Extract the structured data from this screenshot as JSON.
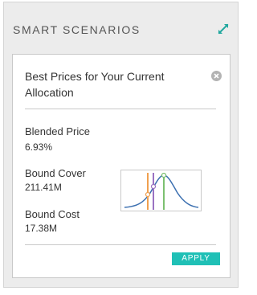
{
  "panel": {
    "title": "SMART SCENARIOS",
    "expand_icon": "expand-icon"
  },
  "card": {
    "title": "Best Prices for Your Current Allocation",
    "close_icon": "close-icon",
    "metrics": [
      {
        "label": "Blended Price",
        "value": "6.93%"
      },
      {
        "label": "Bound Cover",
        "value": "211.41M"
      },
      {
        "label": "Bound Cost",
        "value": "17.38M"
      }
    ],
    "apply_label": "APPLY"
  },
  "colors": {
    "accent": "#20c0b6",
    "curve": "#3b6fb0",
    "marker_orange": "#f0a050",
    "marker_purple": "#9b72c2",
    "marker_green": "#7cc070"
  }
}
